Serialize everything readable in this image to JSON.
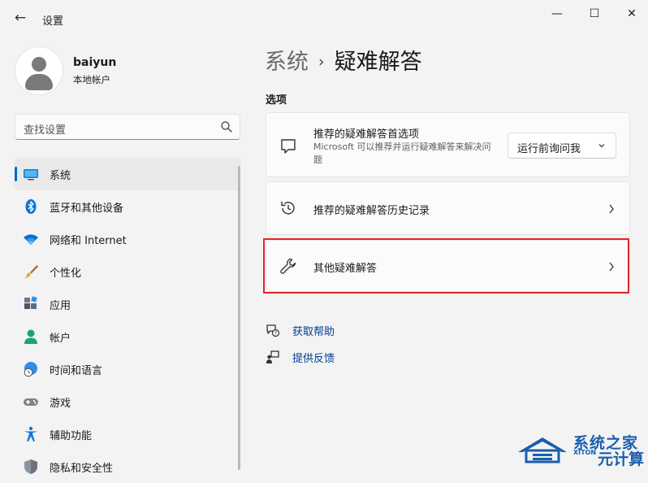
{
  "window": {
    "title": "设置",
    "back_glyph": "←",
    "minimize_glyph": "—",
    "maximize_glyph": "☐",
    "close_glyph": "✕"
  },
  "profile": {
    "name": "baiyun",
    "account_type": "本地帐户"
  },
  "search": {
    "placeholder": "查找设置"
  },
  "sidebar": {
    "items": [
      {
        "label": "系统",
        "icon": "system-display-icon",
        "active": true
      },
      {
        "label": "蓝牙和其他设备",
        "icon": "bluetooth-icon"
      },
      {
        "label": "网络和 Internet",
        "icon": "wifi-icon"
      },
      {
        "label": "个性化",
        "icon": "paintbrush-icon"
      },
      {
        "label": "应用",
        "icon": "apps-icon"
      },
      {
        "label": "帐户",
        "icon": "account-icon"
      },
      {
        "label": "时间和语言",
        "icon": "time-language-icon"
      },
      {
        "label": "游戏",
        "icon": "gamepad-icon"
      },
      {
        "label": "辅助功能",
        "icon": "accessibility-icon"
      },
      {
        "label": "隐私和安全性",
        "icon": "shield-icon"
      }
    ]
  },
  "main": {
    "breadcrumb_parent": "系统",
    "breadcrumb_separator": "›",
    "breadcrumb_current": "疑难解答",
    "section_label": "选项",
    "cards": [
      {
        "title": "推荐的疑难解答首选项",
        "description": "Microsoft 可以推荐并运行疑难解答来解决问题",
        "icon": "chat-bubble-icon",
        "dropdown_value": "运行前询问我"
      },
      {
        "title": "推荐的疑难解答历史记录",
        "icon": "history-icon"
      },
      {
        "title": "其他疑难解答",
        "icon": "wrench-icon",
        "highlighted": true
      }
    ],
    "links": [
      {
        "label": "获取帮助",
        "icon": "help-chat-icon"
      },
      {
        "label": "提供反馈",
        "icon": "feedback-icon"
      }
    ]
  },
  "watermark": {
    "line1": "系统之家",
    "line2": "XITON",
    "line3": "元计算"
  },
  "colors": {
    "accent": "#0067c0",
    "highlight_border": "#e0252d",
    "link": "#003e92",
    "background": "#f3f3f3"
  }
}
